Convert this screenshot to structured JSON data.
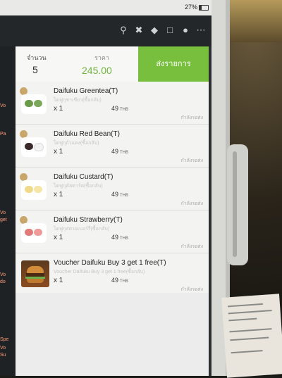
{
  "status_bar": {
    "battery_text": "27%"
  },
  "toolbar": {
    "icons": [
      "search-icon",
      "crossed-tools-icon",
      "tag-icon",
      "lock-icon",
      "user-icon",
      "more-icon"
    ]
  },
  "order_header": {
    "qty_label": "จำนวน",
    "qty_value": "5",
    "price_label": "ราคา",
    "price_value": "245.00",
    "send_button": "ส่งรายการ"
  },
  "items": [
    {
      "name": "Daifuku Greentea(T)",
      "subtitle": "ไดฟูกุชาเขียว(ซื้อกลับ)",
      "qty": "x 1",
      "price": "49",
      "currency": "THB",
      "status": "กำลังรอส่ง",
      "thumb_colors": [
        "#6a9a4a",
        "#7aa85a"
      ]
    },
    {
      "name": "Daifuku Red Bean(T)",
      "subtitle": "ไดฟูกุถั่วแดง(ซื้อกลับ)",
      "qty": "x 1",
      "price": "49",
      "currency": "THB",
      "status": "กำลังรอส่ง",
      "thumb_colors": [
        "#3a2a2a",
        "#f2f2f2"
      ]
    },
    {
      "name": "Daifuku Custard(T)",
      "subtitle": "ไดฟูกุคัสตาร์ด(ซื้อกลับ)",
      "qty": "x 1",
      "price": "49",
      "currency": "THB",
      "status": "กำลังรอส่ง",
      "thumb_colors": [
        "#f0d98a",
        "#f5e6a8"
      ]
    },
    {
      "name": "Daifuku Strawberry(T)",
      "subtitle": "ไดฟูกุสตรอเบอร์รี่(ซื้อกลับ)",
      "qty": "x 1",
      "price": "49",
      "currency": "THB",
      "status": "กำลังรอส่ง",
      "thumb_colors": [
        "#e27a7a",
        "#f09a9a"
      ]
    },
    {
      "name": "Voucher Daifuku Buy 3 get 1 free(T)",
      "subtitle": "Voucher Daifuku Buy 3 get 1 free(ซื้อกลับ)",
      "qty": "x 1",
      "price": "49",
      "currency": "THB",
      "status": "กำลังรอส่ง"
    }
  ],
  "left_menu": [
    "Vo",
    "Pa",
    "Vo",
    "get",
    "Vo",
    "do",
    "Spe",
    "Vo",
    "Su"
  ]
}
